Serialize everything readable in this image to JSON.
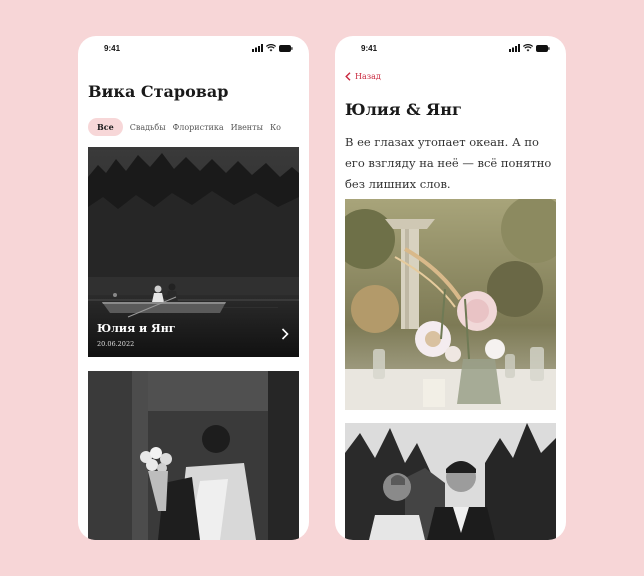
{
  "status": {
    "time": "9:41"
  },
  "list_screen": {
    "title": "Вика Старовар",
    "filters": [
      "Все",
      "Свадьбы",
      "Флористика",
      "Ивенты",
      "Ко"
    ],
    "cards": [
      {
        "title": "Юлия и Янг",
        "date": "20.06.2022"
      }
    ]
  },
  "detail_screen": {
    "back_label": "Назад",
    "title": "Юлия & Янг",
    "description": "В ее глазах утопает океан. А по его взгляду на неё — всё понятно без лишних слов."
  },
  "colors": {
    "background": "#f7d6d7",
    "accent": "#c9283e",
    "chip_active": "#f7d7d8"
  }
}
